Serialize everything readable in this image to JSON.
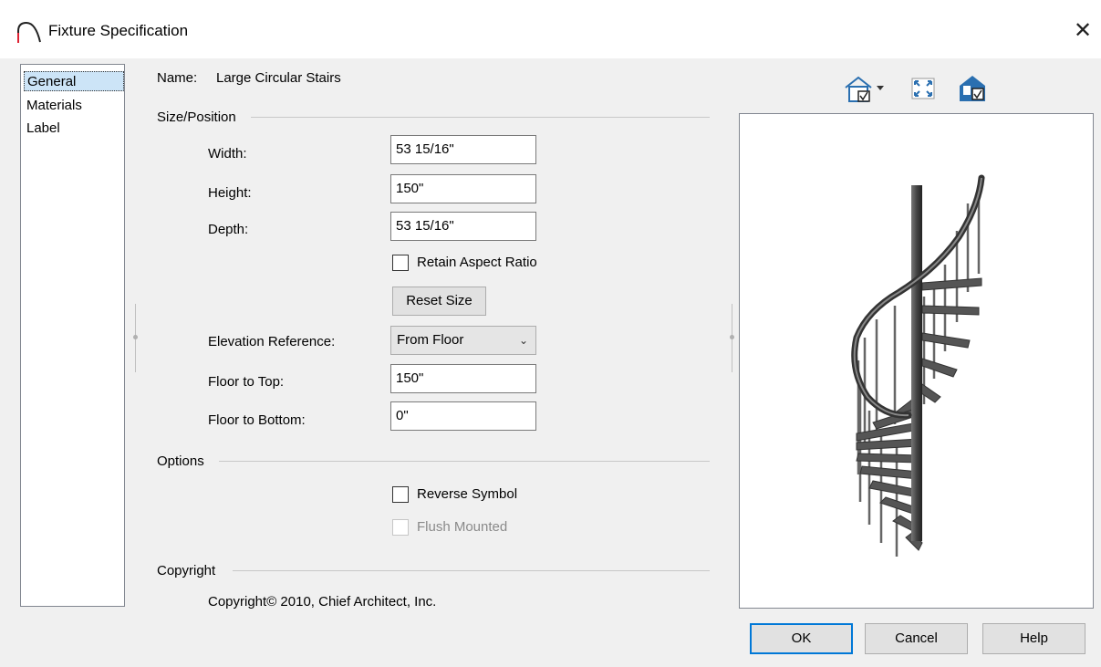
{
  "window": {
    "title": "Fixture Specification"
  },
  "nav": {
    "items": [
      "General",
      "Materials",
      "Label"
    ]
  },
  "general": {
    "name_label": "Name:",
    "name_value": "Large Circular Stairs",
    "size_section": "Size/Position",
    "width_label": "Width:",
    "width_value": "53 15/16\"",
    "height_label": "Height:",
    "height_value": "150\"",
    "depth_label": "Depth:",
    "depth_value": "53 15/16\"",
    "retain_aspect_label": "Retain Aspect Ratio",
    "reset_size_label": "Reset Size",
    "elevation_ref_label": "Elevation Reference:",
    "elevation_ref_value": "From Floor",
    "floor_top_label": "Floor to Top:",
    "floor_top_value": "150\"",
    "floor_bottom_label": "Floor to Bottom:",
    "floor_bottom_value": "0\"",
    "options_section": "Options",
    "reverse_symbol_label": "Reverse Symbol",
    "flush_mounted_label": "Flush Mounted",
    "copyright_section": "Copyright",
    "copyright_text": "Copyright© 2010, Chief Architect, Inc."
  },
  "preview_toolbar": {
    "icons": [
      "house-view-icon",
      "fit-window-icon",
      "house-checkbox-icon"
    ]
  },
  "footer": {
    "ok_label": "OK",
    "cancel_label": "Cancel",
    "help_label": "Help"
  },
  "colors": {
    "accent": "#0078d7",
    "selected_bg": "#cce4f7",
    "house_icon": "#2a6fb0"
  }
}
